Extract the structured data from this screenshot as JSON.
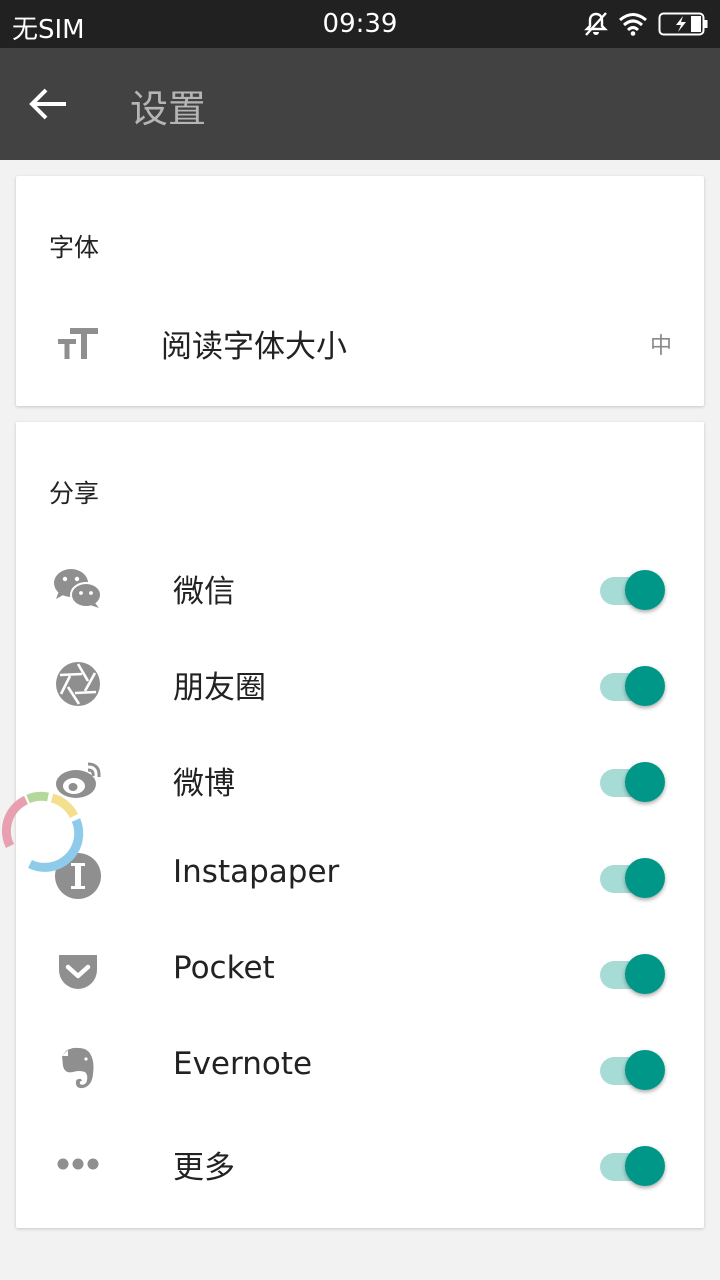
{
  "status_bar": {
    "carrier": "无SIM",
    "time": "09:39"
  },
  "app_bar": {
    "title": "设置"
  },
  "font_section": {
    "title": "字体",
    "item": {
      "icon": "font-size-icon",
      "label": "阅读字体大小",
      "value": "中"
    }
  },
  "share_section": {
    "title": "分享",
    "items": [
      {
        "icon": "wechat-icon",
        "label": "微信",
        "enabled": true
      },
      {
        "icon": "moments-icon",
        "label": "朋友圈",
        "enabled": true
      },
      {
        "icon": "weibo-icon",
        "label": "微博",
        "enabled": true
      },
      {
        "icon": "instapaper-icon",
        "label": "Instapaper",
        "enabled": true
      },
      {
        "icon": "pocket-icon",
        "label": "Pocket",
        "enabled": true
      },
      {
        "icon": "evernote-icon",
        "label": "Evernote",
        "enabled": true
      },
      {
        "icon": "more-icon",
        "label": "更多",
        "enabled": true
      }
    ]
  },
  "colors": {
    "accent": "#009688",
    "track": "#a7dcd6",
    "app_bar": "#424242",
    "status_bar": "#212121"
  }
}
